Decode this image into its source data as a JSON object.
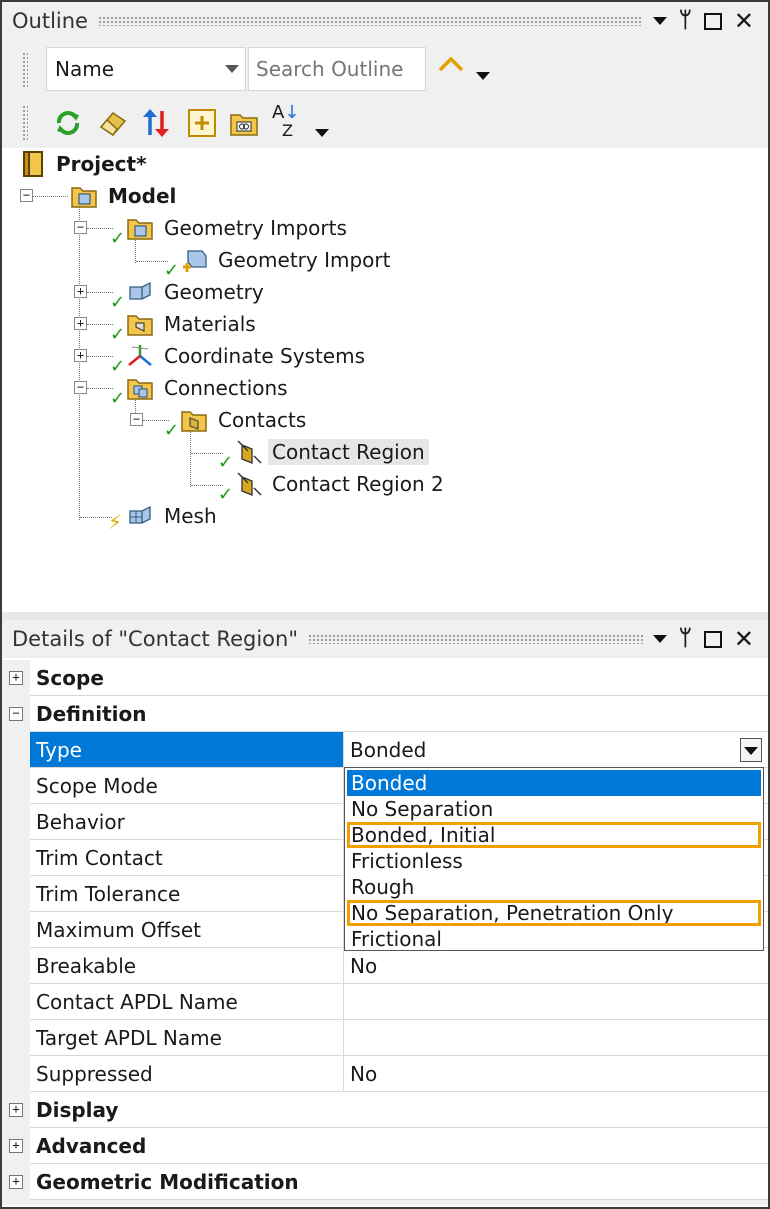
{
  "outline": {
    "title": "Outline",
    "filter_select": "Name",
    "search_placeholder": "Search Outline"
  },
  "tree": {
    "project": "Project*",
    "model": "Model",
    "geometry_imports": "Geometry Imports",
    "geometry_import": "Geometry Import",
    "geometry": "Geometry",
    "materials": "Materials",
    "coordinate_systems": "Coordinate Systems",
    "connections": "Connections",
    "contacts": "Contacts",
    "contact_region": "Contact Region",
    "contact_region_2": "Contact Region 2",
    "mesh": "Mesh"
  },
  "details": {
    "title": "Details of \"Contact Region\"",
    "categories": {
      "scope": "Scope",
      "definition": "Definition",
      "display": "Display",
      "advanced": "Advanced",
      "geometric_modification": "Geometric Modification"
    },
    "properties": [
      {
        "name": "Type",
        "value": "Bonded"
      },
      {
        "name": "Scope Mode",
        "value": ""
      },
      {
        "name": "Behavior",
        "value": ""
      },
      {
        "name": "Trim Contact",
        "value": ""
      },
      {
        "name": "Trim Tolerance",
        "value": ""
      },
      {
        "name": "Maximum Offset",
        "value": ""
      },
      {
        "name": "Breakable",
        "value": "No"
      },
      {
        "name": "Contact APDL Name",
        "value": ""
      },
      {
        "name": "Target APDL Name",
        "value": ""
      },
      {
        "name": "Suppressed",
        "value": "No"
      }
    ],
    "type_options": [
      "Bonded",
      "No Separation",
      "Bonded, Initial",
      "Frictionless",
      "Rough",
      "No Separation, Penetration Only",
      "Frictional"
    ]
  },
  "colors": {
    "selection_blue": "#0078d7",
    "highlight_orange": "#f0a000",
    "check_green": "#1a9a1a"
  }
}
